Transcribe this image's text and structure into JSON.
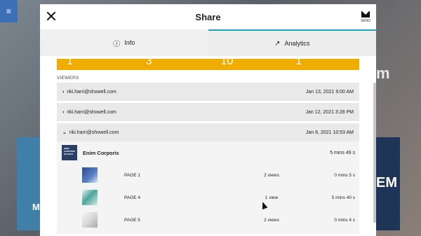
{
  "background": {
    "menu_glyph": "≡",
    "left_card_text": "M",
    "right_card_text": "EM",
    "right_top_text": "m"
  },
  "header": {
    "title": "Share",
    "send_label": "SEND"
  },
  "tabs": [
    {
      "label": "Info",
      "icon": "info-icon",
      "active": false
    },
    {
      "label": "Analytics",
      "icon": "trending-up-icon",
      "active": true
    }
  ],
  "stats": [
    "1",
    "3",
    "10",
    "1"
  ],
  "viewers_label": "VIEWERS",
  "viewers": [
    {
      "email": "riki.harri@showell.com",
      "date": "Jan 13, 2021 9:00 AM",
      "expanded": false
    },
    {
      "email": "riki.harri@showell.com",
      "date": "Jan 12, 2021 3:28 PM",
      "expanded": false
    },
    {
      "email": "riki.harri@showell.com",
      "date": "Jan 8, 2021 10:53 AM",
      "expanded": true
    }
  ],
  "document": {
    "thumb_text": "ENIM CORPORIS NATHIUS",
    "name": "Enim Corporis",
    "time": "5 mins 49 s",
    "pages": [
      {
        "name": "PAGE 1",
        "views": "2 views",
        "time": "0 mins 5 s"
      },
      {
        "name": "PAGE 4",
        "views": "1 view",
        "time": "5 mins 40 s"
      },
      {
        "name": "PAGE 5",
        "views": "2 views",
        "time": "0 mins 4 s"
      }
    ]
  },
  "colors": {
    "accent": "#1aa3b8",
    "stats_bar": "#f0ad00"
  }
}
